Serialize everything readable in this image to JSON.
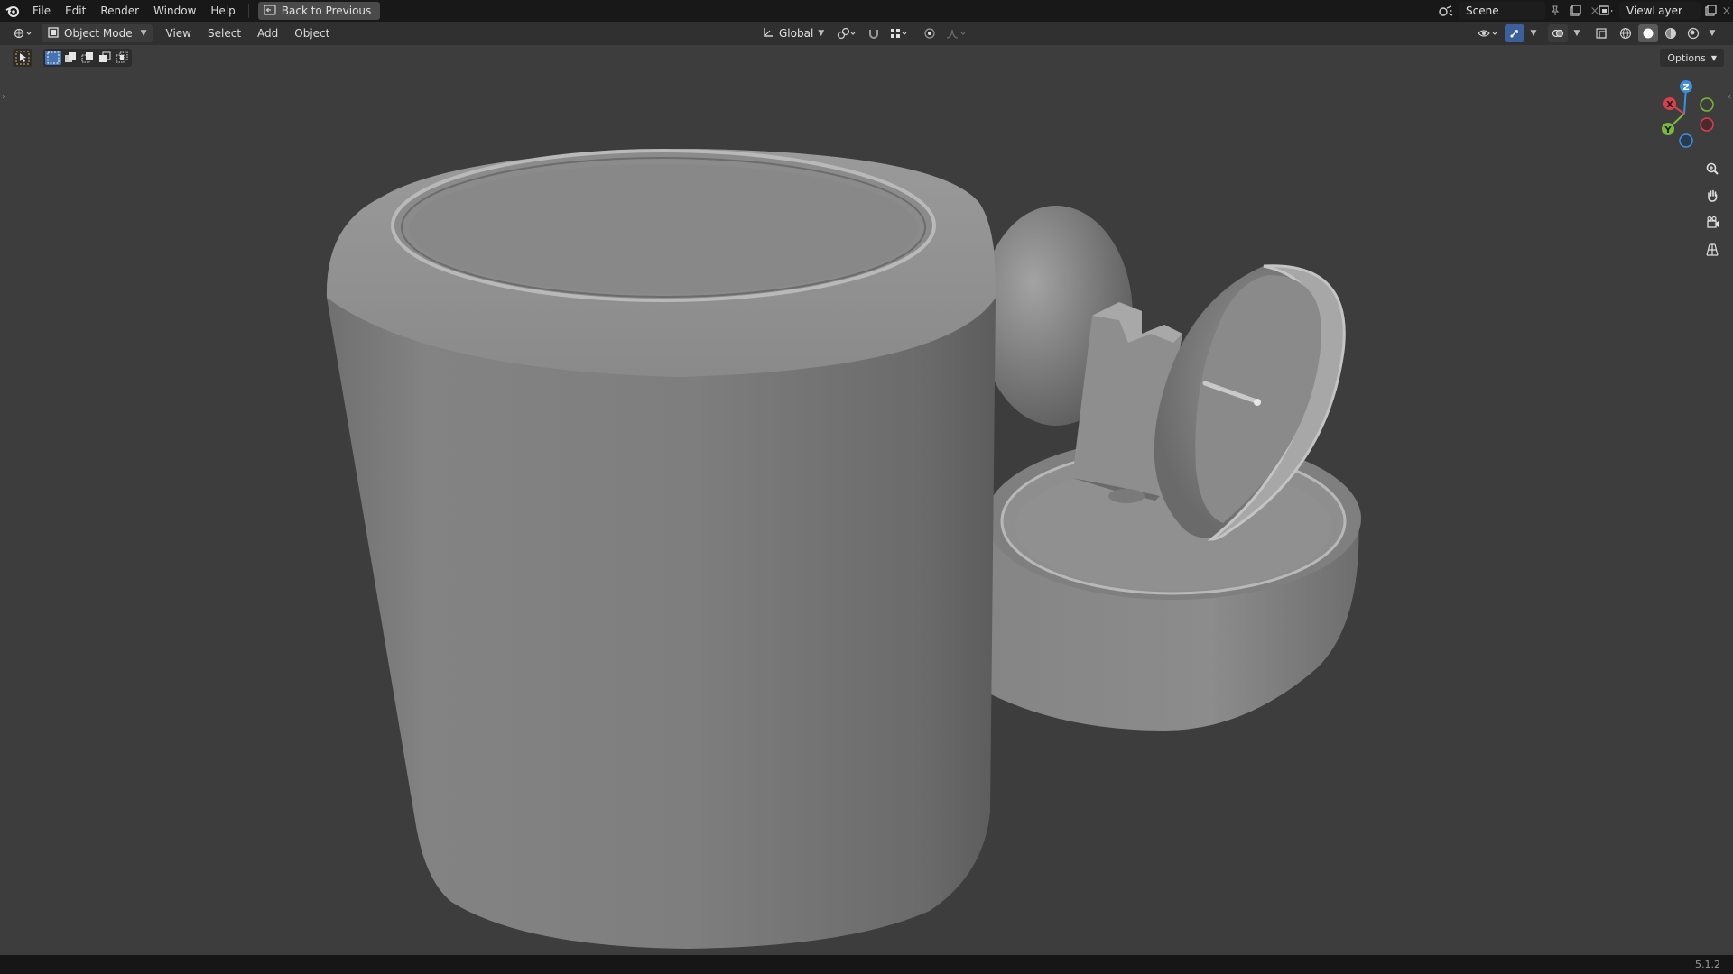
{
  "topbar": {
    "menu": [
      "File",
      "Edit",
      "Render",
      "Window",
      "Help"
    ],
    "back_button": "Back to Previous",
    "scene": "Scene",
    "view_layer": "ViewLayer"
  },
  "header": {
    "mode": "Object Mode",
    "menu": [
      "View",
      "Select",
      "Add",
      "Object"
    ],
    "transform_orientation": "Global"
  },
  "options_label": "Options",
  "gizmo": {
    "z": "Z",
    "x": "X",
    "y": "Y"
  },
  "status": {
    "version": "5.1.2"
  },
  "colors": {
    "axis_x": "#d6404f",
    "axis_y": "#7ab83a",
    "axis_z": "#3d8fe0",
    "viewport_bg": "#3d3d3d"
  }
}
